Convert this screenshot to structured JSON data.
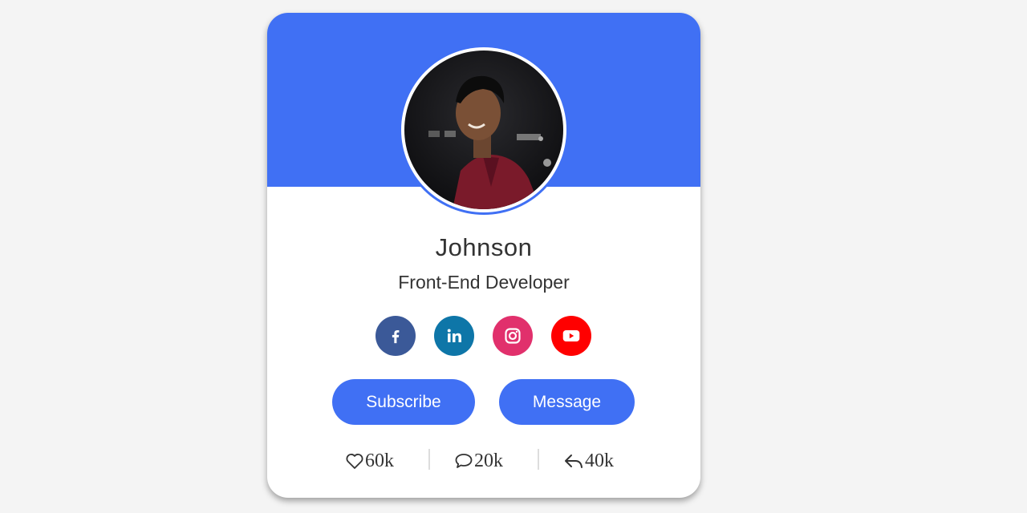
{
  "profile": {
    "name": "Johnson",
    "job": "Front-End Developer",
    "avatar_alt": "profile photo"
  },
  "social": [
    {
      "name": "facebook",
      "icon": "facebook-icon",
      "color": "#3b5998"
    },
    {
      "name": "linkedin",
      "icon": "linkedin-icon",
      "color": "#0e76a8"
    },
    {
      "name": "instagram",
      "icon": "instagram-icon",
      "color": "#e1306c"
    },
    {
      "name": "youtube",
      "icon": "youtube-icon",
      "color": "#ff0000"
    }
  ],
  "buttons": {
    "subscribe": "Subscribe",
    "message": "Message"
  },
  "stats": {
    "likes": "60k",
    "comments": "20k",
    "shares": "40k"
  },
  "colors": {
    "accent": "#4070f4",
    "background": "#f4f4f4",
    "card": "#ffffff",
    "text": "#333333"
  }
}
